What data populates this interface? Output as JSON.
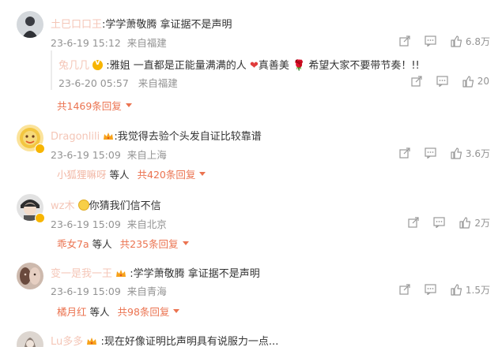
{
  "comments": [
    {
      "username": "土巳口口王",
      "text": ":学学萧敬腾 拿证据不是声明",
      "time": "23-6-19 15:12",
      "location": "来自福建",
      "likes": "6.8万",
      "avatar_colors": [
        "#cfd3d6",
        "#3d3f45"
      ],
      "sub_reply": {
        "username": "兔几几",
        "text": ":雅姐 一直都是正能量满满的人",
        "heart": "❤",
        "text2": "真善美",
        "rose": "🌹",
        "text3": " 希望大家不要带节奏！!!",
        "time": "23-6-20 05:57",
        "location": "来自福建",
        "likes": "20"
      },
      "replies_total": "共1469条回复"
    },
    {
      "username": "Dragonlili",
      "text": ":我觉得去验个头发自证比较靠谱",
      "time": "23-6-19 15:09",
      "location": "来自上海",
      "likes": "3.6万",
      "replies_names": "小狐狸嘛呀",
      "replies_deng": "等人",
      "replies_total": "共420条回复",
      "avatar_colors": [
        "#f3c640",
        "#e05a2b"
      ]
    },
    {
      "username": "wz木",
      "text": "你猜我们信不信",
      "time": "23-6-19 15:09",
      "location": "来自北京",
      "likes": "2万",
      "replies_names": "乖女7a",
      "replies_deng": "等人",
      "replies_total": "共235条回复",
      "avatar_colors": [
        "#d9d9d9",
        "#303030"
      ]
    },
    {
      "username": "变一是我一王",
      "text": ":学学萧敬腾 拿证据不是声明",
      "time": "23-6-19 15:09",
      "location": "来自青海",
      "likes": "1.5万",
      "replies_names": "橘月红",
      "replies_deng": "等人",
      "replies_total": "共98条回复",
      "avatar_colors": [
        "#c9b4a8",
        "#5a3d33"
      ]
    },
    {
      "username": "Lu多多",
      "text": ":现在好像证明比声明具有说服力一点...",
      "avatar_colors": [
        "#d8d2cc",
        "#8a7d74"
      ]
    }
  ],
  "colors": {
    "accent": "#eb7350",
    "muted": "#939393",
    "badge": "#f7b500"
  },
  "icons": {
    "share": "share-icon",
    "comment": "comment-icon",
    "like": "thumbs-up-icon"
  }
}
